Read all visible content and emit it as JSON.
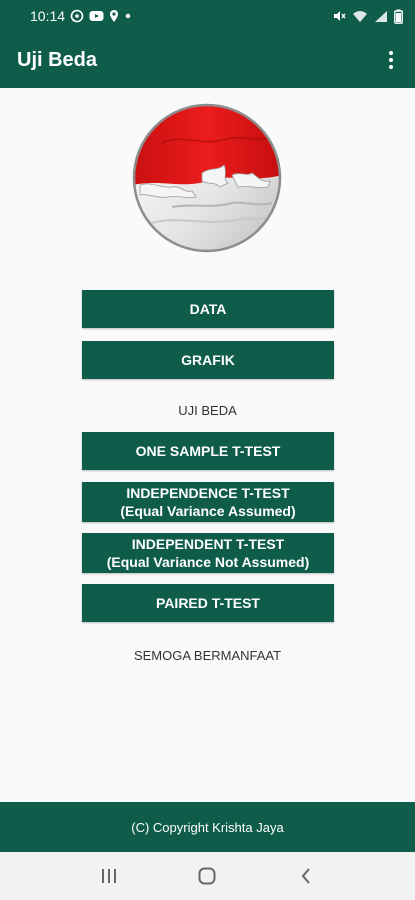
{
  "status_bar": {
    "time": "10:14",
    "left_icons": [
      "whatsapp-icon",
      "youtube-icon",
      "location-icon",
      "dot-icon"
    ],
    "right_icons": [
      "mute-icon",
      "wifi-icon",
      "signal-icon",
      "battery-icon"
    ]
  },
  "app_bar": {
    "title": "Uji Beda",
    "menu_icon": "more-vert-icon"
  },
  "logo": {
    "description_icon": "indonesia-flag-globe-icon",
    "colors": {
      "red": "#e01b1b",
      "white": "#f2f2f2"
    }
  },
  "buttons": {
    "data": "DATA",
    "grafik": "GRAFIK",
    "one_sample": "ONE SAMPLE T-TEST",
    "independence_line1": "INDEPENDENCE T-TEST",
    "independence_line2": "(Equal Variance Assumed)",
    "independent_line1": "INDEPENDENT T-TEST",
    "independent_line2": "(Equal Variance Not Assumed)",
    "paired": "PAIRED T-TEST"
  },
  "labels": {
    "section": "UJI BEDA",
    "closing": "SEMOGA BERMANFAAT"
  },
  "footer": {
    "copyright": "(C) Copyright Krishta Jaya"
  },
  "nav_bar": {
    "recents_icon": "recents-icon",
    "home_icon": "home-icon",
    "back_icon": "back-icon"
  },
  "colors": {
    "primary": "#0f5c4b",
    "background": "#fafafa"
  }
}
